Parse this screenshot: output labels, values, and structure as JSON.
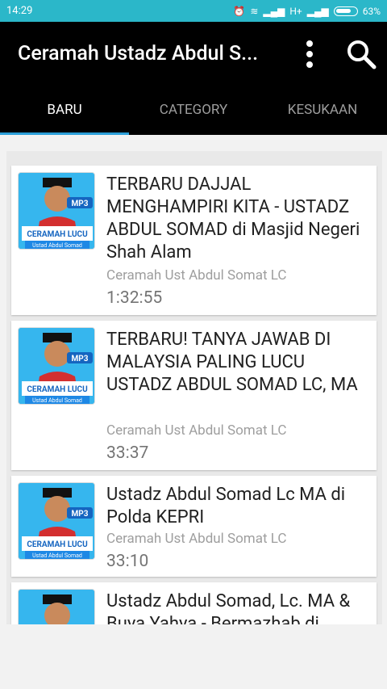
{
  "status": {
    "time": "14:29",
    "network": "H+",
    "battery": "63%"
  },
  "app": {
    "title": "Ceramah Ustadz Abdul S..."
  },
  "tabs": [
    {
      "label": "BARU"
    },
    {
      "label": "CATEGORY"
    },
    {
      "label": "KESUKAAN"
    }
  ],
  "thumb": {
    "badge": "MP3",
    "line1": "CERAMAH LUCU",
    "line2": "Ustad Abdul Somad"
  },
  "items": [
    {
      "title": "TERBARU DAJJAL MENGHAMPIRI KITA - USTADZ ABDUL SOMAD di Masjid Negeri Shah Alam",
      "channel": "Ceramah Ust Abdul Somat LC",
      "duration": "1:32:55"
    },
    {
      "title": "TERBARU! TANYA JAWAB DI MALAYSIA PALING LUCU USTADZ ABDUL SOMAD LC, MA",
      "channel": "Ceramah Ust Abdul Somat LC",
      "duration": "33:37"
    },
    {
      "title": "Ustadz Abdul Somad Lc MA di Polda KEPRI",
      "channel": "Ceramah Ust Abdul Somat LC",
      "duration": "33:10"
    },
    {
      "title": "Ustadz Abdul Somad, Lc. MA & Buya Yahya - Bermazhab di",
      "channel": "",
      "duration": ""
    }
  ]
}
